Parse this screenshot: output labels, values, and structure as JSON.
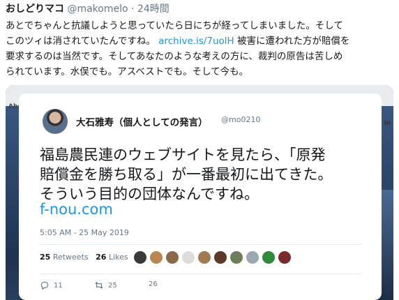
{
  "tweet": {
    "display_name": "おしどりマコ",
    "handle": "@makomelo",
    "separator": "·",
    "time": "24時間",
    "line1": "あとでちゃんと抗議しようと思っていたら日にちが経ってしまいました。そして",
    "line2_pre": "このツィは消されていたんですね。 ",
    "line2_link": "archive.is/7uolH",
    "line2_post": " 被害に遭われた方が賠償を",
    "line3": "要求するのは当然です。そしてあなたのような考えの方に、裁判の原告は苦しめ",
    "line4": "られています。水俣でも。アスベストでも。そして今も。"
  },
  "background": {
    "left_text": "Abo",
    "right_text": "g in"
  },
  "quoted": {
    "display_name": "大石雅寿（個人としての発言）",
    "handle": "@mo0210",
    "text_line1": "福島農民連のウェブサイトを見たら、「原発",
    "text_line2": "賠償金を勝ち取る」が一番最初に出てきた。",
    "text_line3": "そういう目的の団体なんですね。",
    "link": "f-nou.com",
    "timestamp": "5:05 AM - 25 May 2019",
    "retweet_count": "25",
    "retweet_label": "Retweets",
    "like_count": "26",
    "like_label": "Likes",
    "reply_action_count": "11",
    "retweet_action_count": "25",
    "like_action_count": "26"
  },
  "colors": {
    "link": "#1b95e0",
    "muted": "#657786"
  }
}
